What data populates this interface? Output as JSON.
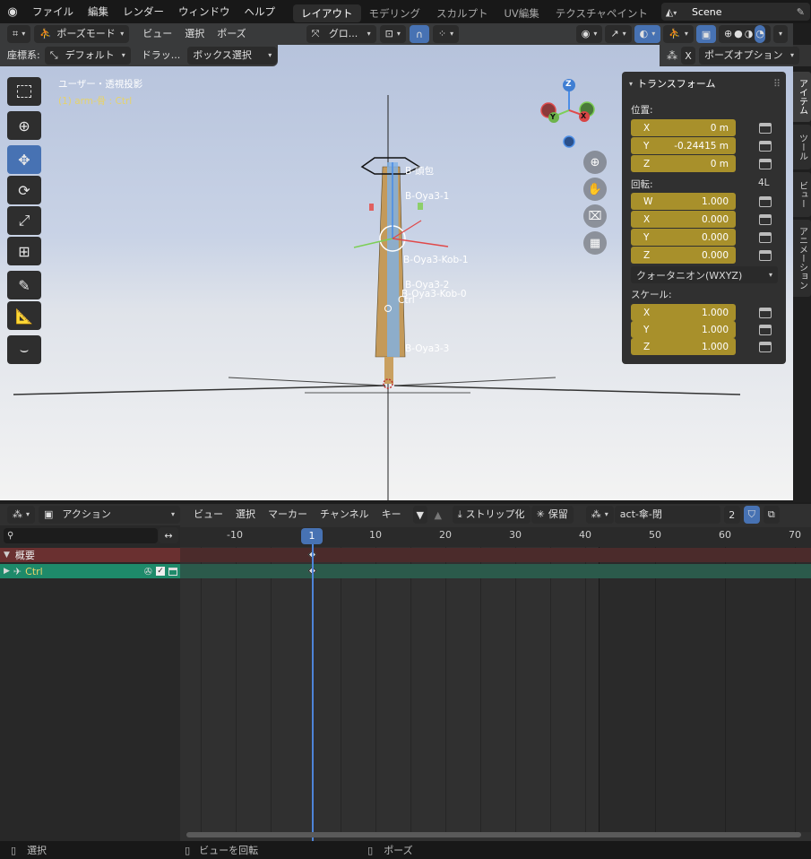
{
  "topbar": {
    "menus": [
      "ファイル",
      "編集",
      "レンダー",
      "ウィンドウ",
      "ヘルプ"
    ],
    "workspaces": [
      "レイアウト",
      "モデリング",
      "スカルプト",
      "UV編集",
      "テクスチャペイント"
    ],
    "active_workspace": "レイアウト",
    "scene_name": "Scene"
  },
  "viewport": {
    "mode": "ポーズモード",
    "menus": [
      "ビュー",
      "選択",
      "ポーズ"
    ],
    "orientation": "グロ...",
    "coord_label": "座標系:",
    "coord_value": "デフォルト",
    "drag_label": "ドラッ...",
    "drag_value": "ボックス選択",
    "pose_options": "ポーズオプション",
    "x_label": "X",
    "view_title": "ユーザー・透視投影",
    "view_subtitle": "(1) arm-骨 : Ctrl",
    "bone_labels": [
      "B-頭包",
      "B-Oya3-1",
      "B-Oya3-Kob-1",
      "B-Oya3-2",
      "B-Oya3-Kob-0",
      "Ctrl",
      "B-Oya3-3"
    ],
    "gizmo_axes": {
      "z": "Z",
      "y": "Y",
      "x": "X"
    }
  },
  "npanel": {
    "title": "トランスフォーム",
    "location_label": "位置:",
    "location": [
      {
        "axis": "X",
        "value": "0 m"
      },
      {
        "axis": "Y",
        "value": "-0.24415 m"
      },
      {
        "axis": "Z",
        "value": "0 m"
      }
    ],
    "rotation_label": "回転:",
    "rotation_mode_short": "4L",
    "rotation": [
      {
        "axis": "W",
        "value": "1.000"
      },
      {
        "axis": "X",
        "value": "0.000"
      },
      {
        "axis": "Y",
        "value": "0.000"
      },
      {
        "axis": "Z",
        "value": "0.000"
      }
    ],
    "rotation_mode": "クォータニオン(WXYZ)",
    "scale_label": "スケール:",
    "scale": [
      {
        "axis": "X",
        "value": "1.000"
      },
      {
        "axis": "Y",
        "value": "1.000"
      },
      {
        "axis": "Z",
        "value": "1.000"
      }
    ],
    "side_tabs": [
      "アイテム",
      "ツール",
      "ビュー",
      "アニメーション"
    ]
  },
  "dopesheet": {
    "mode": "アクション",
    "menus": [
      "ビュー",
      "選択",
      "マーカー",
      "チャンネル",
      "キー"
    ],
    "push_down": "ストリップ化",
    "stash": "保留",
    "action_name": "act-傘-閉",
    "users": "2",
    "ruler": [
      "-10",
      "10",
      "20",
      "30",
      "40",
      "50",
      "60",
      "70"
    ],
    "current_frame": "1",
    "channels": {
      "summary": "概要",
      "ctrl": "Ctrl"
    }
  },
  "statusbar": {
    "select": "選択",
    "rotate": "ビューを回転",
    "pose": "ポーズ"
  },
  "colors": {
    "accent": "#4772b3",
    "field": "#a8902b",
    "summary": "#6a3030",
    "channel": "#1e8a6a"
  }
}
